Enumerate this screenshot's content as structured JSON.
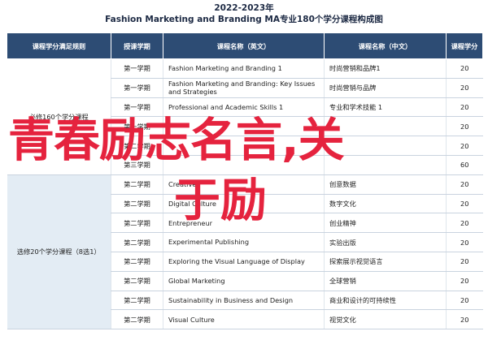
{
  "title": {
    "line1": "2022-2023年",
    "line2": "Fashion Marketing and Branding MA专业180个学分课程构成图"
  },
  "headers": {
    "group": "课程学分满足规则",
    "semester": "授课学期",
    "name_en": "课程名称（英文）",
    "name_zh": "课程名称（中文）",
    "credits": "课程学分"
  },
  "required_group": {
    "label": "必修160个学分课程",
    "rows": [
      {
        "semester": "第一学期",
        "en": "Fashion Marketing and Branding 1",
        "zh": "时尚营销和品牌1",
        "credits": "20"
      },
      {
        "semester": "第一学期",
        "en": "Fashion Marketing and Branding: Key Issues and Strategies",
        "zh": "时尚营销与品牌",
        "credits": "20"
      },
      {
        "semester": "第一学期",
        "en": "Professional and Academic Skills 1",
        "zh": "专业和学术技能 1",
        "credits": "20"
      },
      {
        "semester": "第一学期",
        "en": "",
        "zh": "",
        "credits": "20"
      },
      {
        "semester": "第二学期",
        "en": "",
        "zh": "",
        "credits": "20"
      },
      {
        "semester": "第三学期",
        "en": "",
        "zh": "",
        "credits": "60"
      }
    ]
  },
  "elective_group": {
    "label": "选修20个学分课程（8选1）",
    "rows": [
      {
        "semester": "第二学期",
        "en": "Creative",
        "zh": "创意数据",
        "credits": "20"
      },
      {
        "semester": "第二学期",
        "en": "Digital Culture",
        "zh": "数字文化",
        "credits": "20"
      },
      {
        "semester": "第二学期",
        "en": "Entrepreneur",
        "zh": "创业精神",
        "credits": "20"
      },
      {
        "semester": "第二学期",
        "en": "Experimental Publishing",
        "zh": "实验出版",
        "credits": "20"
      },
      {
        "semester": "第二学期",
        "en": "Exploring the Visual Language of Display",
        "zh": "探索展示视觉语言",
        "credits": "20"
      },
      {
        "semester": "第二学期",
        "en": "Global Marketing",
        "zh": "全球营销",
        "credits": "20"
      },
      {
        "semester": "第二学期",
        "en": "Sustainability in Business and Design",
        "zh": "商业和设计的可持续性",
        "credits": "20"
      },
      {
        "semester": "第二学期",
        "en": "Visual Culture",
        "zh": "视觉文化",
        "credits": "20"
      }
    ]
  },
  "overlay": {
    "line1": "青春励志名言,关",
    "line2": "于励"
  },
  "colors": {
    "header_bg": "#2d4c74",
    "elective_group_bg": "#e3ecf4",
    "overlay_text": "#e5233e"
  }
}
